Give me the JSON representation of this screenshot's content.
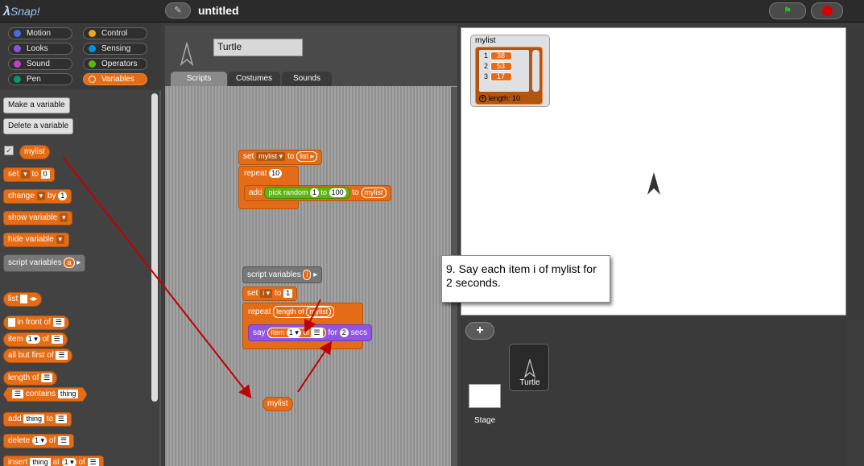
{
  "app": {
    "logo": "Snap!",
    "title": "untitled"
  },
  "toolbar": {
    "edit_icon": "pencil-icon",
    "flag_icon": "green-flag-icon",
    "stop_icon": "stop-icon"
  },
  "categories": [
    {
      "label": "Motion",
      "color": "#4a6cd4"
    },
    {
      "label": "Control",
      "color": "#e6a822"
    },
    {
      "label": "Looks",
      "color": "#8a55d7"
    },
    {
      "label": "Sensing",
      "color": "#0094dd"
    },
    {
      "label": "Sound",
      "color": "#bb42c3"
    },
    {
      "label": "Operators",
      "color": "#5cb712"
    },
    {
      "label": "Pen",
      "color": "#009870"
    },
    {
      "label": "Variables",
      "color": "#e46c16"
    }
  ],
  "palette": {
    "make_variable": "Make a variable",
    "delete_variable": "Delete a variable",
    "var_name": "mylist",
    "blocks": {
      "set": "set",
      "to": "to",
      "zero": "0",
      "change": "change",
      "by": "by",
      "one": "1",
      "show_variable": "show variable",
      "hide_variable": "hide variable",
      "script_variables": "script variables",
      "a": "a",
      "list": "list",
      "in_front_of": "in front of",
      "item": "item",
      "of": "of",
      "all_but_first_of": "all but first of",
      "length_of": "length of",
      "contains": "contains",
      "thing": "thing",
      "add": "add",
      "delete": "delete",
      "insert": "insert",
      "at": "at"
    }
  },
  "sprite": {
    "name": "Turtle",
    "tabs": [
      "Scripts",
      "Costumes",
      "Sounds"
    ]
  },
  "scripts": {
    "s1": {
      "set": "set",
      "var": "mylist",
      "to": "to",
      "list": "list",
      "repeat": "repeat",
      "ten": "10",
      "add": "add",
      "pick_random": "pick random",
      "from": "1",
      "to2": "to",
      "upto": "100",
      "to3": "to",
      "target": "mylist"
    },
    "s2": {
      "script_variables": "script variables",
      "i": "i",
      "set": "set",
      "var": "i",
      "to": "to",
      "one": "1",
      "repeat": "repeat",
      "length_of": "length of",
      "list": "mylist",
      "say": "say",
      "item": "item",
      "item_idx": "1",
      "of": "of",
      "for": "for",
      "secs_val": "2",
      "secs": "secs"
    },
    "loose": "mylist"
  },
  "stage": {
    "watcher": {
      "title": "mylist",
      "rows": [
        {
          "index": "1",
          "value": "38"
        },
        {
          "index": "2",
          "value": "53"
        },
        {
          "index": "3",
          "value": "17"
        }
      ],
      "length_label": "length: 10"
    },
    "callout": "9.  Say each item i of mylist for 2 seconds."
  },
  "corral": {
    "stage_label": "Stage",
    "sprite_label": "Turtle",
    "add_icon": "plus-icon"
  }
}
